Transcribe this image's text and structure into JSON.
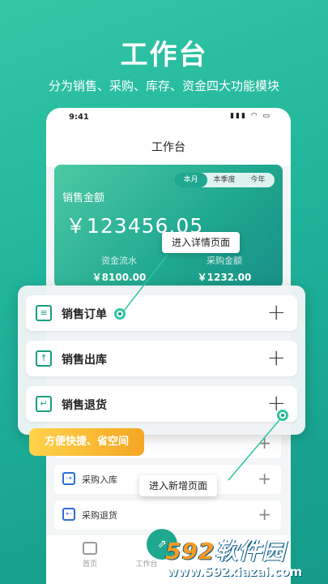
{
  "hero": {
    "title": "工作台",
    "subtitle": "分为销售、采购、库存、资金四大功能模块"
  },
  "status_bar": {
    "time": "9:41",
    "icons_text": "▮▮▮ ◠ ▭"
  },
  "nav": {
    "title": "工作台"
  },
  "card": {
    "tabs": [
      "本月",
      "本季度",
      "今年"
    ],
    "active_tab": "本月",
    "label": "销售金额",
    "amount": "￥123456.05",
    "stat_left_label": "资金流水",
    "stat_left_value": "￥8100.00",
    "stat_right_label": "采购金额",
    "stat_right_value": "￥1232.00"
  },
  "back_list": [
    {
      "label": "采购入库",
      "icon": "truck-icon"
    },
    {
      "label": "采购退货",
      "icon": "truck-return-icon"
    }
  ],
  "panel": {
    "rows": [
      {
        "label": "销售订单",
        "icon": "clipboard-icon"
      },
      {
        "label": "销售出库",
        "icon": "outbound-icon"
      },
      {
        "label": "销售退货",
        "icon": "return-icon"
      }
    ],
    "plus": "+"
  },
  "tooltips": {
    "detail": "进入详情页面",
    "add": "进入新增页面"
  },
  "badge": "方便快捷、省空间",
  "tabbar": {
    "home": "首页",
    "workbench": "工作台"
  },
  "watermark": {
    "num": "592",
    "text": "软件园",
    "url": "www.592xiazai.com"
  },
  "colors": {
    "accent": "#1fa890",
    "badge": "#f5a623",
    "icon_blue": "#2e6fd6"
  }
}
